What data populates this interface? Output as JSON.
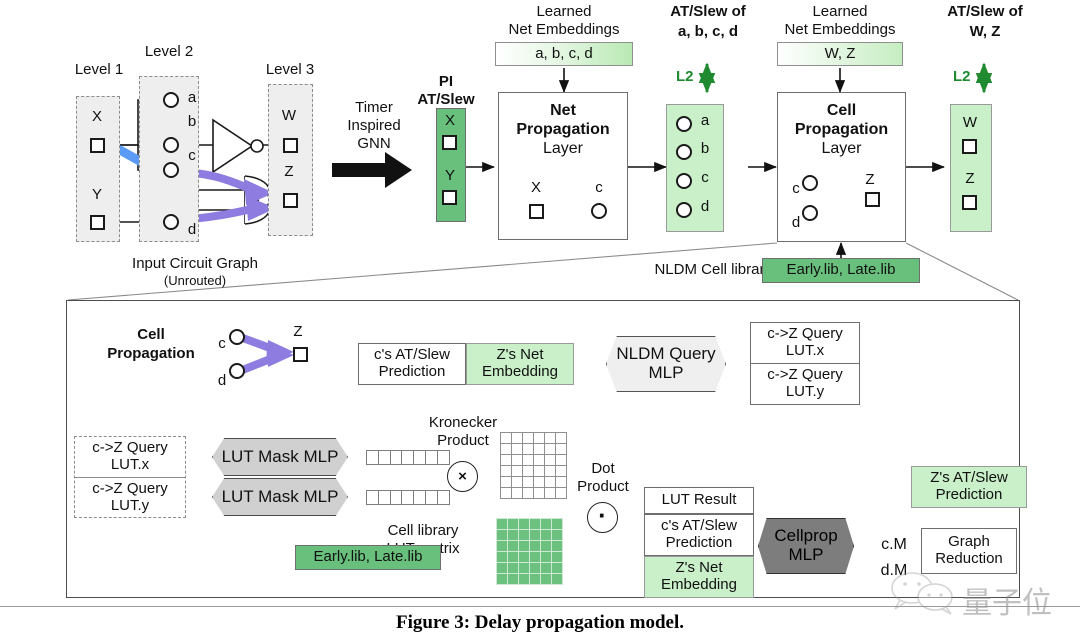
{
  "figure": {
    "caption": "Figure 3: Delay propagation model.",
    "watermark_text": "量子位"
  },
  "circuit": {
    "level_labels": [
      "Level 1",
      "Level 2",
      "Level 3"
    ],
    "pins_level1": [
      "X",
      "Y"
    ],
    "pins_level2": [
      "a",
      "b",
      "c",
      "d"
    ],
    "pins_level3": [
      "W",
      "Z"
    ],
    "title": "Input Circuit Graph",
    "subtitle": "(Unrouted)"
  },
  "gnn_arrow": {
    "line1": "Timer",
    "line2": "Inspired",
    "line3": "GNN"
  },
  "net_stage": {
    "pi_label_line1": "PI",
    "pi_label_line2": "AT/Slew",
    "pi_pins": [
      "X",
      "Y"
    ],
    "embeddings_title_line1": "Learned",
    "embeddings_title_line2": "Net Embeddings",
    "embeddings_value": "a, b, c, d",
    "layer_line1": "Net",
    "layer_line2": "Propagation",
    "layer_line3": "Layer",
    "mini_src": "X",
    "mini_dst": "c",
    "out_title_line1": "AT/Slew of",
    "out_title_line2": "a, b, c, d",
    "out_loss": "L2",
    "out_pins": [
      "a",
      "b",
      "c",
      "d"
    ]
  },
  "cell_stage": {
    "embeddings_title_line1": "Learned",
    "embeddings_title_line2": "Net Embeddings",
    "embeddings_value": "W, Z",
    "layer_line1": "Cell",
    "layer_line2": "Propagation",
    "layer_line3": "Layer",
    "mini_src1": "c",
    "mini_src2": "d",
    "mini_dst": "Z",
    "out_title_line1": "AT/Slew of",
    "out_title_line2": "W, Z",
    "out_loss": "L2",
    "out_pins": [
      "W",
      "Z"
    ],
    "library_label": "NLDM Cell library",
    "library_value": "Early.lib, Late.lib"
  },
  "detail": {
    "title_line1": "Cell",
    "title_line2": "Propagation",
    "mini_src1": "c",
    "mini_src2": "d",
    "mini_dst": "Z",
    "query_input_left_line1": "c's AT/Slew",
    "query_input_left_line2": "Prediction",
    "query_input_right_line1": "Z's Net",
    "query_input_right_line2": "Embedding",
    "nldm_mlp_line1": "NLDM Query",
    "nldm_mlp_line2": "MLP",
    "query_out_x_line1": "c->Z Query",
    "query_out_x_line2": "LUT.x",
    "query_out_y_line1": "c->Z Query",
    "query_out_y_line2": "LUT.y",
    "lut_in_x_line1": "c->Z Query",
    "lut_in_x_line2": "LUT.x",
    "lut_in_y_line1": "c->Z Query",
    "lut_in_y_line2": "LUT.y",
    "mask_mlp_x": "LUT Mask MLP",
    "mask_mlp_y": "LUT Mask MLP",
    "kronecker_line1": "Kronecker",
    "kronecker_line2": "Product",
    "kron_symbol": "×",
    "dot_line1": "Dot",
    "dot_line2": "Product",
    "dot_symbol": "·",
    "cell_lib_line1": "Cell library",
    "cell_lib_line2": "LUT matrix",
    "cell_lib_value": "Early.lib, Late.lib",
    "result_row1": "LUT Result",
    "result_row2_line1": "c's AT/Slew",
    "result_row2_line2": "Prediction",
    "result_row3_line1": "Z's Net",
    "result_row3_line2": "Embedding",
    "cellprop_mlp_line1": "Cellprop",
    "cellprop_mlp_line2": "MLP",
    "out_cm": "c.M",
    "out_dm": "d.M",
    "graph_reduction_line1": "Graph",
    "graph_reduction_line2": "Reduction",
    "final_line1": "Z's AT/Slew",
    "final_line2": "Prediction",
    "vector_cells": 7,
    "matrix_rows": 6,
    "matrix_cols": 6
  },
  "colors": {
    "green_mid": "#69bf7c",
    "green_light": "#c9f0c9",
    "green_matrix": "#6dc17f",
    "loss_green": "#1f8a2f",
    "arrow_purple": "#8e7ce0",
    "arrow_blue": "#5b9bf5",
    "box_gray": "#eeeeee",
    "mlp_gray": "#d0d0d0",
    "mlp_dark": "#7d7d7d"
  }
}
